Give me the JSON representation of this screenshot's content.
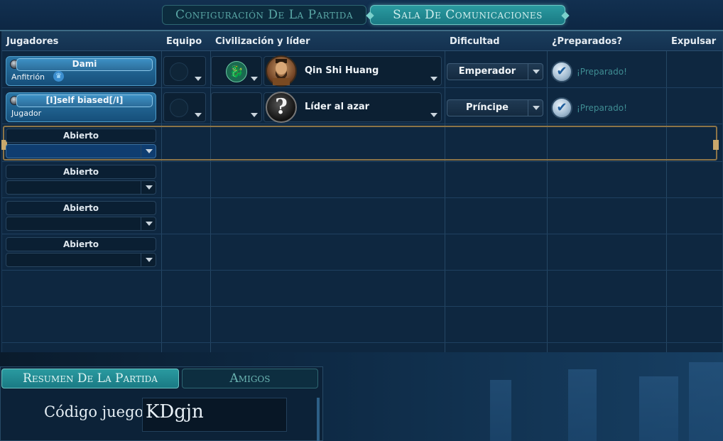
{
  "tabs": {
    "config": "Configuración De La Partida",
    "lobby": "Sala De Comunicaciones"
  },
  "columns": {
    "players": "Jugadores",
    "team": "Equipo",
    "civ_leader": "Civilización y líder",
    "difficulty": "Dificultad",
    "ready": "¿Preparados?",
    "kick": "Expulsar"
  },
  "players": [
    {
      "name": "Dami",
      "role": "Anfitrión",
      "leader": "Qin Shi Huang",
      "difficulty": "Emperador",
      "ready_text": "¡Preparado!",
      "civ_icon": "dragon-icon",
      "leader_icon": "qin-shi-huang-portrait"
    },
    {
      "name": "[I]self biased[/I]",
      "role": "Jugador",
      "leader": "Líder al azar",
      "difficulty": "Príncipe",
      "ready_text": "¡Preparado!",
      "leader_icon": "question-mark-icon"
    }
  ],
  "open_slots": [
    {
      "label": "Abierto"
    },
    {
      "label": "Abierto"
    },
    {
      "label": "Abierto"
    },
    {
      "label": "Abierto"
    }
  ],
  "glyphs": {
    "crown": "♛",
    "dragon": "🐉",
    "question": "?",
    "check": "✔"
  },
  "bottom": {
    "summary_tab": "Resumen De La Partida",
    "friends_tab": "Amigos",
    "code_label": "Código juego:",
    "code_value": "KDgjn"
  },
  "colors": {
    "accent_teal": "#2a9aa0",
    "slot_blue": "#2b76a6",
    "frame_gold": "#8c7448",
    "ready_green": "#3f8d93"
  }
}
